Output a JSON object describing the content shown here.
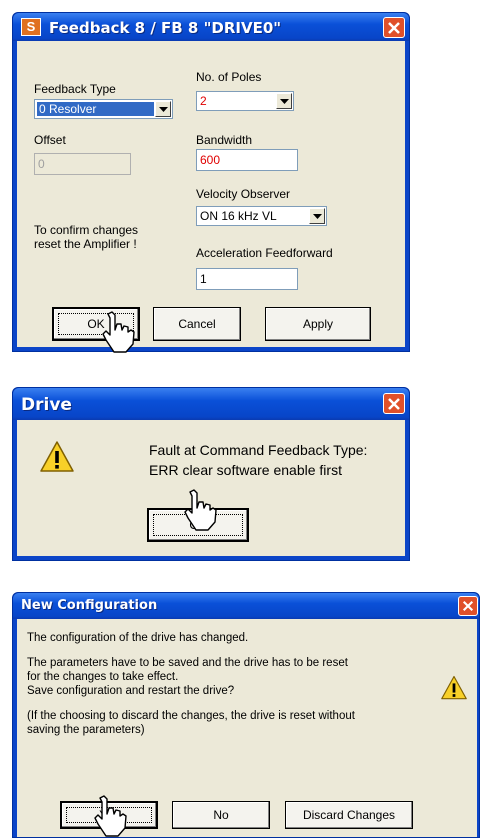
{
  "feedback": {
    "title": "Feedback  8 / FB 8 \"DRIVE0\"",
    "app_icon_letter": "S",
    "feedback_type_label": "Feedback Type",
    "feedback_type_value": "0 Resolver",
    "poles_label": "No. of Poles",
    "poles_value": "2",
    "offset_label": "Offset",
    "offset_value": "0",
    "bandwidth_label": "Bandwidth",
    "bandwidth_value": "600",
    "velocity_label": "Velocity Observer",
    "velocity_value": "ON  16 kHz VL",
    "confirm_line1": "To confirm changes",
    "confirm_line2": "reset the Amplifier !",
    "accel_label": "Acceleration Feedforward",
    "accel_value": "1",
    "ok_label": "OK",
    "cancel_label": "Cancel",
    "apply_label": "Apply"
  },
  "drive": {
    "title": "Drive",
    "message_line1": "Fault at Command  Feedback Type:",
    "message_line2": "ERR clear software enable first",
    "ok_label": "OK"
  },
  "newconfig": {
    "title": "New Configuration",
    "line1": "The configuration of the drive has changed.",
    "line2": "The parameters have to be saved and the drive has to be reset",
    "line3": "for the changes to take effect.",
    "line4": "Save configuration and restart the drive?",
    "line5": "(If the choosing to discard the changes, the drive is reset without",
    "line6": "saving the parameters)",
    "yes_label": "Yes",
    "no_label": "No",
    "discard_label": "Discard Changes"
  },
  "colors": {
    "titlebar": "#0a50d8",
    "dialog_bg": "#ece9d8",
    "close_button": "#e0502a",
    "red_value": "#e00000",
    "selection": "#316ac5"
  }
}
